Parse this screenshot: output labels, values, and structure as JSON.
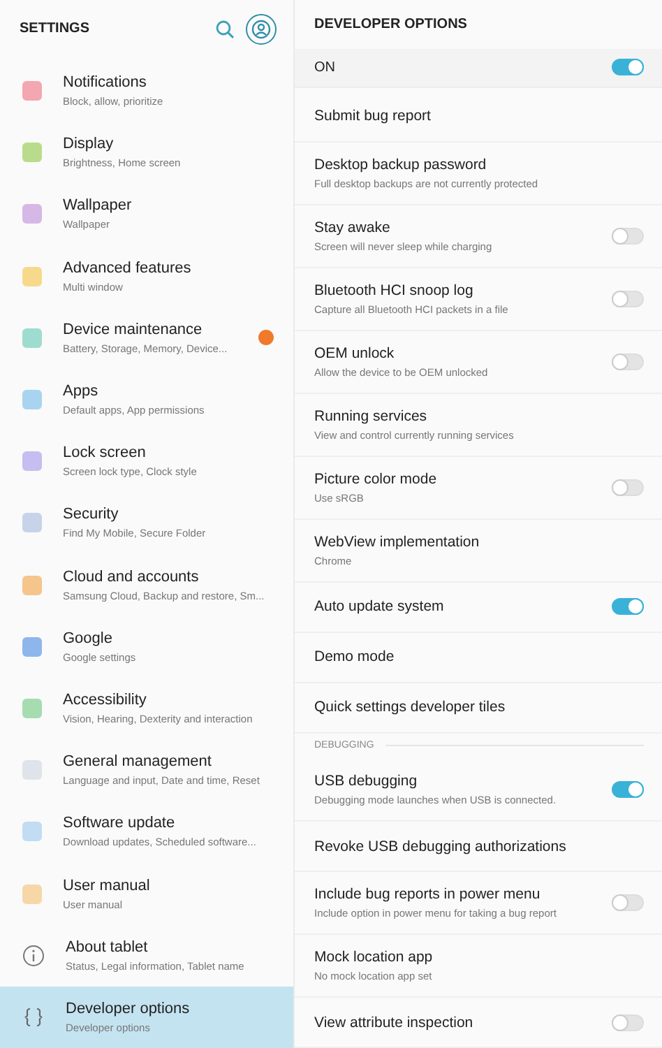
{
  "sidebar": {
    "title": "SETTINGS",
    "items": [
      {
        "kind": "tile",
        "color": "#f4a7b0",
        "title": "Notifications",
        "subtitle": "Block, allow, prioritize",
        "selected": false
      },
      {
        "kind": "tile",
        "color": "#b9dc8c",
        "title": "Display",
        "subtitle": "Brightness, Home screen",
        "selected": false
      },
      {
        "kind": "tile",
        "color": "#d6b8e6",
        "title": "Wallpaper",
        "subtitle": "Wallpaper",
        "selected": false
      },
      {
        "kind": "tile",
        "color": "#f7d98c",
        "title": "Advanced features",
        "subtitle": "Multi window",
        "selected": false
      },
      {
        "kind": "tile",
        "color": "#9fdcd0",
        "title": "Device maintenance",
        "subtitle": "Battery, Storage, Memory, Device...",
        "selected": false,
        "badge": true
      },
      {
        "kind": "tile",
        "color": "#a8d4f0",
        "title": "Apps",
        "subtitle": "Default apps, App permissions",
        "selected": false
      },
      {
        "kind": "tile",
        "color": "#c6bdf0",
        "title": "Lock screen",
        "subtitle": "Screen lock type, Clock style",
        "selected": false
      },
      {
        "kind": "tile",
        "color": "#c7d3e8",
        "title": "Security",
        "subtitle": "Find My Mobile, Secure Folder",
        "selected": false
      },
      {
        "kind": "tile",
        "color": "#f5c58c",
        "title": "Cloud and accounts",
        "subtitle": "Samsung Cloud, Backup and restore, Sm...",
        "selected": false
      },
      {
        "kind": "tile",
        "color": "#8fb6ec",
        "title": "Google",
        "subtitle": "Google settings",
        "selected": false
      },
      {
        "kind": "tile",
        "color": "#a6dcb0",
        "title": "Accessibility",
        "subtitle": "Vision, Hearing, Dexterity and interaction",
        "selected": false
      },
      {
        "kind": "tile",
        "color": "#dfe3ea",
        "title": "General management",
        "subtitle": "Language and input, Date and time, Reset",
        "selected": false
      },
      {
        "kind": "tile",
        "color": "#c2dcf3",
        "title": "Software update",
        "subtitle": "Download updates, Scheduled software...",
        "selected": false
      },
      {
        "kind": "tile",
        "color": "#f6d8a8",
        "title": "User manual",
        "subtitle": "User manual",
        "selected": false
      },
      {
        "kind": "info",
        "title": "About tablet",
        "subtitle": "Status, Legal information, Tablet name",
        "selected": false
      },
      {
        "kind": "braces",
        "title": "Developer options",
        "subtitle": "Developer options",
        "selected": true
      }
    ]
  },
  "panel": {
    "title": "DEVELOPER OPTIONS",
    "master": {
      "label": "ON",
      "on": true
    },
    "rows": [
      {
        "kind": "item",
        "title": "Submit bug report"
      },
      {
        "kind": "item",
        "title": "Desktop backup password",
        "subtitle": "Full desktop backups are not currently protected"
      },
      {
        "kind": "item",
        "title": "Stay awake",
        "subtitle": "Screen will never sleep while charging",
        "on": false
      },
      {
        "kind": "item",
        "title": "Bluetooth HCI snoop log",
        "subtitle": "Capture all Bluetooth HCI packets in a file",
        "on": false
      },
      {
        "kind": "item",
        "title": "OEM unlock",
        "subtitle": "Allow the device to be OEM unlocked",
        "on": false
      },
      {
        "kind": "item",
        "title": "Running services",
        "subtitle": "View and control currently running services"
      },
      {
        "kind": "item",
        "title": "Picture color mode",
        "subtitle": "Use sRGB",
        "on": false
      },
      {
        "kind": "item",
        "title": "WebView implementation",
        "subtitle": "Chrome"
      },
      {
        "kind": "item",
        "title": "Auto update system",
        "on": true
      },
      {
        "kind": "item",
        "title": "Demo mode"
      },
      {
        "kind": "item",
        "title": "Quick settings developer tiles"
      },
      {
        "kind": "header",
        "title": "DEBUGGING"
      },
      {
        "kind": "item",
        "title": "USB debugging",
        "subtitle": "Debugging mode launches when USB is connected.",
        "on": true
      },
      {
        "kind": "item",
        "title": "Revoke USB debugging authorizations"
      },
      {
        "kind": "item",
        "title": "Include bug reports in power menu",
        "subtitle": "Include option in power menu for taking a bug report",
        "on": false
      },
      {
        "kind": "item",
        "title": "Mock location app",
        "subtitle": "No mock location app set"
      },
      {
        "kind": "item",
        "title": "View attribute inspection",
        "on": false
      }
    ]
  }
}
